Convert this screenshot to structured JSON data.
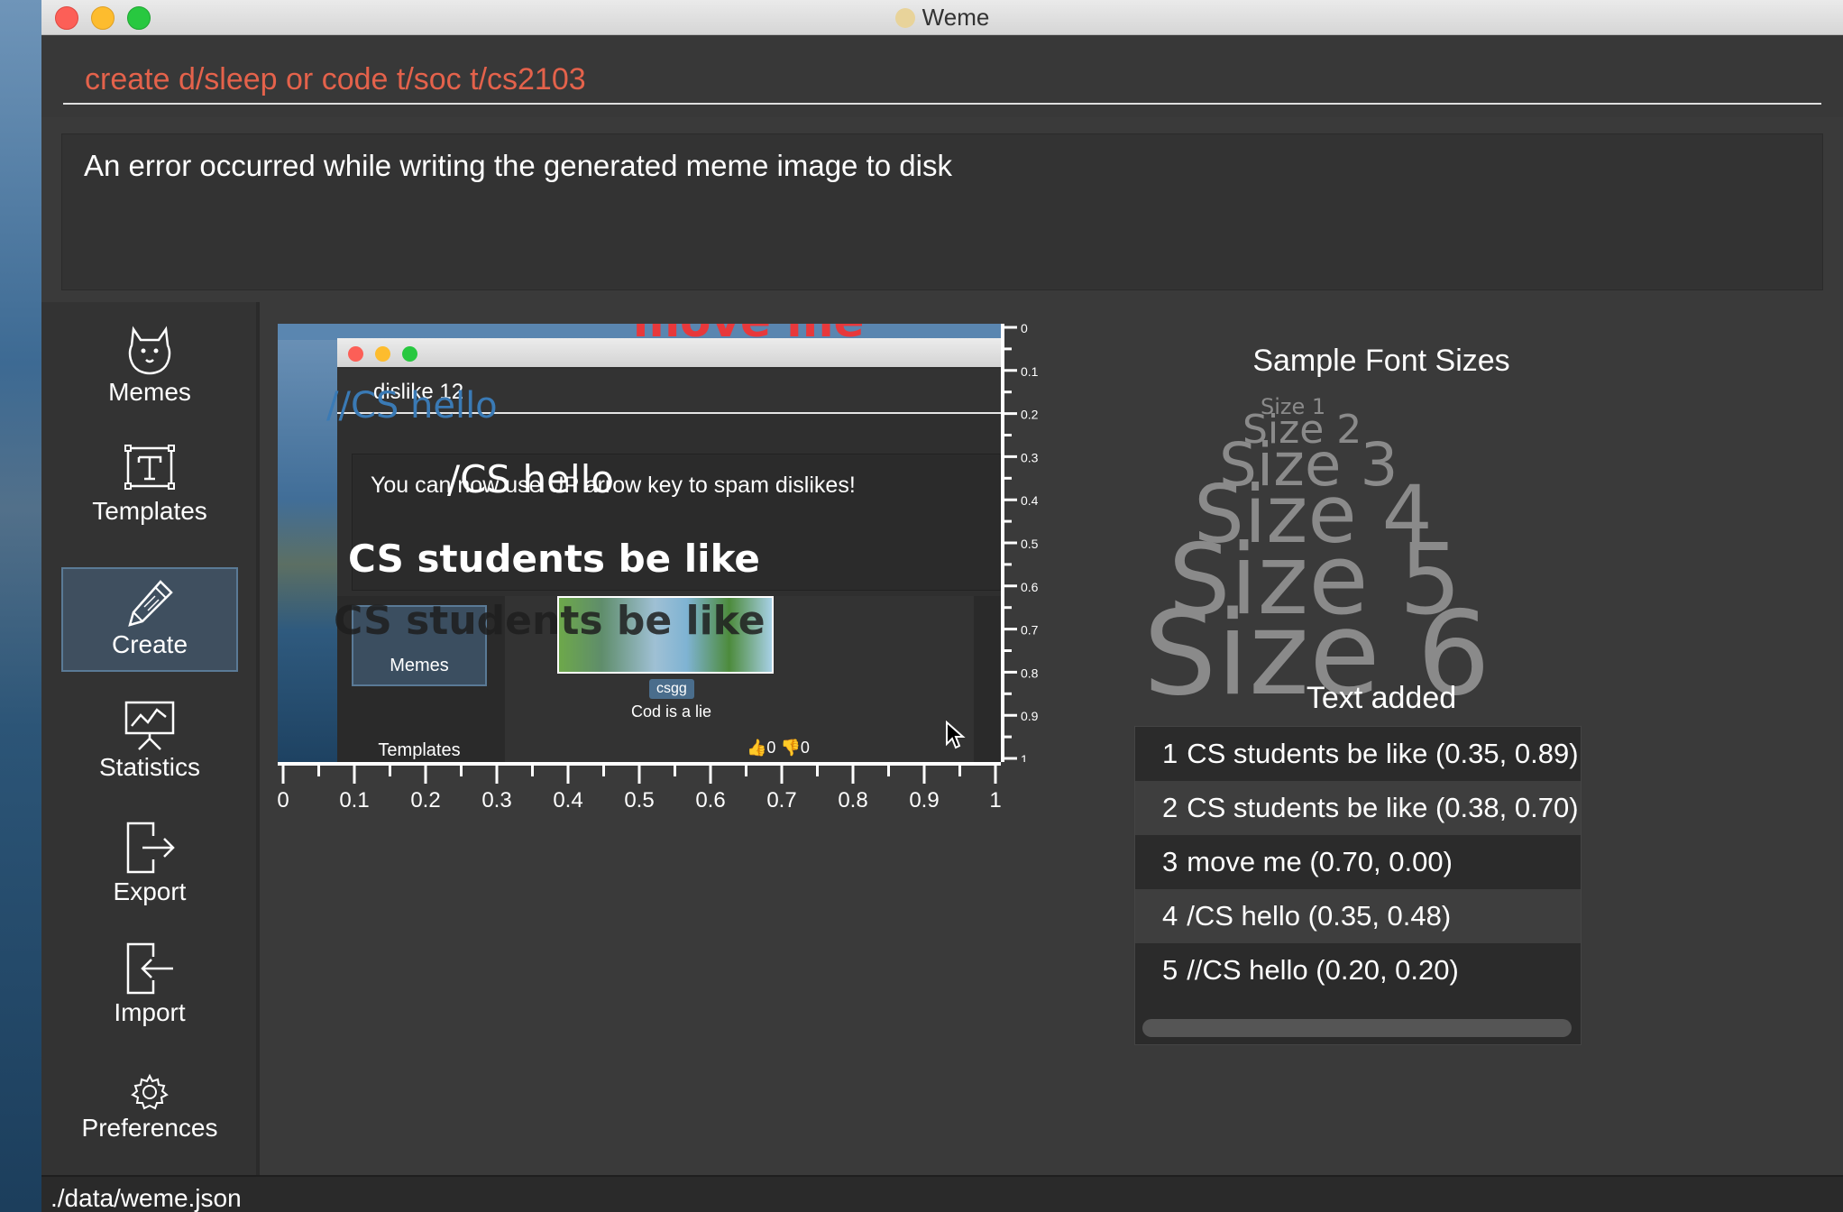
{
  "window": {
    "title": "Weme"
  },
  "command": {
    "value": "create d/sleep or code t/soc t/cs2103"
  },
  "result": {
    "message": "An error occurred while writing the generated meme image to disk"
  },
  "sidebar": {
    "items": [
      {
        "label": "Memes",
        "icon": "doge-icon"
      },
      {
        "label": "Templates",
        "icon": "template-icon"
      },
      {
        "label": "Create",
        "icon": "pencil-icon",
        "active": true
      },
      {
        "label": "Statistics",
        "icon": "statistics-icon"
      },
      {
        "label": "Export",
        "icon": "export-icon"
      },
      {
        "label": "Import",
        "icon": "import-icon"
      },
      {
        "label": "Preferences",
        "icon": "gear-icon"
      }
    ]
  },
  "meme": {
    "inner_command": "dislike 12",
    "inner_result": "You can now use UP arrow key to spam dislikes!",
    "inner_memes_label": "Memes",
    "inner_templates_label": "Templates",
    "inner_tag": "csgg",
    "inner_caption": "Cod is a lie",
    "inner_likes": "0",
    "inner_dislikes": "0",
    "overlays": [
      {
        "text": "CS students be like",
        "color": "#1d1d1d"
      },
      {
        "text": "CS students be like",
        "color": "#ffffff"
      },
      {
        "text": "move me",
        "color": "#e8383b"
      },
      {
        "text": "/CS hello",
        "color": "#ffffff"
      },
      {
        "text": "//CS hello",
        "color": "#3a7ab5"
      }
    ]
  },
  "rulers": {
    "x_ticks": [
      "0",
      "0.1",
      "0.2",
      "0.3",
      "0.4",
      "0.5",
      "0.6",
      "0.7",
      "0.8",
      "0.9",
      "1"
    ],
    "y_ticks": [
      "0",
      "0.1",
      "0.2",
      "0.3",
      "0.4",
      "0.5",
      "0.6",
      "0.7",
      "0.8",
      "0.9",
      "1"
    ]
  },
  "font_sizes": {
    "title": "Sample Font Sizes",
    "samples": [
      "Size 1",
      "Size 2",
      "Size 3",
      "Size 4",
      "Size 5",
      "Size 6"
    ]
  },
  "text_added": {
    "title": "Text added",
    "items": [
      {
        "index": "1",
        "text": "CS students be like",
        "coords": "(0.35, 0.89)"
      },
      {
        "index": "2",
        "text": "CS students be like",
        "coords": "(0.38, 0.70)"
      },
      {
        "index": "3",
        "text": "move me",
        "coords": "(0.70, 0.00)"
      },
      {
        "index": "4",
        "text": "/CS hello",
        "coords": "(0.35, 0.48)"
      },
      {
        "index": "5",
        "text": "//CS hello",
        "coords": "(0.20, 0.20)"
      }
    ]
  },
  "status": {
    "path": "./data/weme.json"
  }
}
